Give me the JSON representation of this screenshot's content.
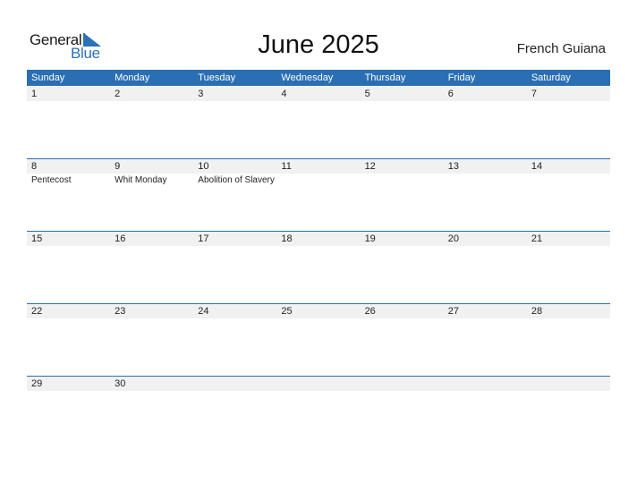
{
  "logo": {
    "line1": "General",
    "line2": "Blue",
    "accent_color": "#2a71b8"
  },
  "title": "June 2025",
  "country": "French Guiana",
  "colors": {
    "header_bg": "#2a6fb3",
    "strip_bg": "#f1f1f1"
  },
  "weekdays": [
    "Sunday",
    "Monday",
    "Tuesday",
    "Wednesday",
    "Thursday",
    "Friday",
    "Saturday"
  ],
  "weeks": [
    {
      "days": [
        {
          "num": "1",
          "event": ""
        },
        {
          "num": "2",
          "event": ""
        },
        {
          "num": "3",
          "event": ""
        },
        {
          "num": "4",
          "event": ""
        },
        {
          "num": "5",
          "event": ""
        },
        {
          "num": "6",
          "event": ""
        },
        {
          "num": "7",
          "event": ""
        }
      ]
    },
    {
      "days": [
        {
          "num": "8",
          "event": "Pentecost"
        },
        {
          "num": "9",
          "event": "Whit Monday"
        },
        {
          "num": "10",
          "event": "Abolition of Slavery"
        },
        {
          "num": "11",
          "event": ""
        },
        {
          "num": "12",
          "event": ""
        },
        {
          "num": "13",
          "event": ""
        },
        {
          "num": "14",
          "event": ""
        }
      ]
    },
    {
      "days": [
        {
          "num": "15",
          "event": ""
        },
        {
          "num": "16",
          "event": ""
        },
        {
          "num": "17",
          "event": ""
        },
        {
          "num": "18",
          "event": ""
        },
        {
          "num": "19",
          "event": ""
        },
        {
          "num": "20",
          "event": ""
        },
        {
          "num": "21",
          "event": ""
        }
      ]
    },
    {
      "days": [
        {
          "num": "22",
          "event": ""
        },
        {
          "num": "23",
          "event": ""
        },
        {
          "num": "24",
          "event": ""
        },
        {
          "num": "25",
          "event": ""
        },
        {
          "num": "26",
          "event": ""
        },
        {
          "num": "27",
          "event": ""
        },
        {
          "num": "28",
          "event": ""
        }
      ]
    },
    {
      "days": [
        {
          "num": "29",
          "event": ""
        },
        {
          "num": "30",
          "event": ""
        },
        {
          "num": "",
          "event": ""
        },
        {
          "num": "",
          "event": ""
        },
        {
          "num": "",
          "event": ""
        },
        {
          "num": "",
          "event": ""
        },
        {
          "num": "",
          "event": ""
        }
      ]
    }
  ]
}
